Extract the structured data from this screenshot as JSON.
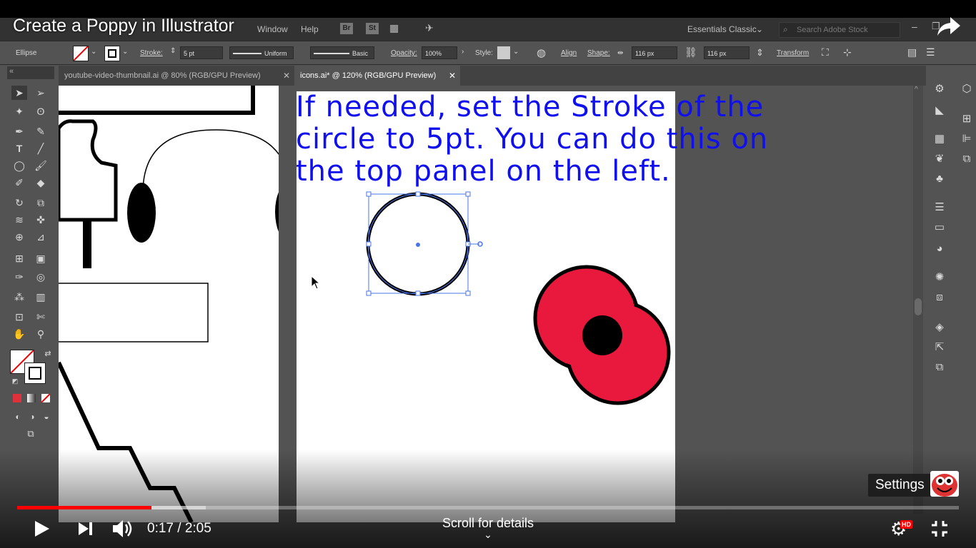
{
  "video": {
    "title": "Create a Poppy in Illustrator",
    "time_current": "0:17",
    "time_total": "2:05",
    "time_sep": " / ",
    "scroll_hint": "Scroll for details",
    "settings_tooltip": "Settings",
    "hd_badge": "HD",
    "progress_played": 0.143,
    "progress_buffered": 0.2
  },
  "menubar": {
    "items": [
      "Window",
      "Help"
    ],
    "bridge": "Br",
    "stock": "St",
    "workspace": "Essentials Classic",
    "search_placeholder": "Search Adobe Stock"
  },
  "control_bar": {
    "object_type": "Ellipse",
    "stroke_label": "Stroke:",
    "stroke_weight": "5 pt",
    "profile_uniform": "Uniform",
    "brush_basic": "Basic",
    "opacity_label": "Opacity:",
    "opacity_value": "100%",
    "style_label": "Style:",
    "align_label": "Align",
    "shape_label": "Shape:",
    "width_value": "116 px",
    "height_value": "116 px",
    "transform_label": "Transform"
  },
  "tabs": [
    {
      "label": "youtube-video-thumbnail.ai @ 80% (RGB/GPU Preview)",
      "close": "✕"
    },
    {
      "label": "icons.ai* @ 120% (RGB/GPU Preview)",
      "close": "✕"
    }
  ],
  "canvas": {
    "caption_lines": [
      "If needed, set the Stroke of the",
      "circle to 5pt. You can do this on",
      "the top panel on the left."
    ]
  },
  "colors": {
    "poppy_red": "#e8193c",
    "caption_blue": "#1010ee",
    "selection_blue": "#4a74e8",
    "progress_red": "#ff0000"
  }
}
